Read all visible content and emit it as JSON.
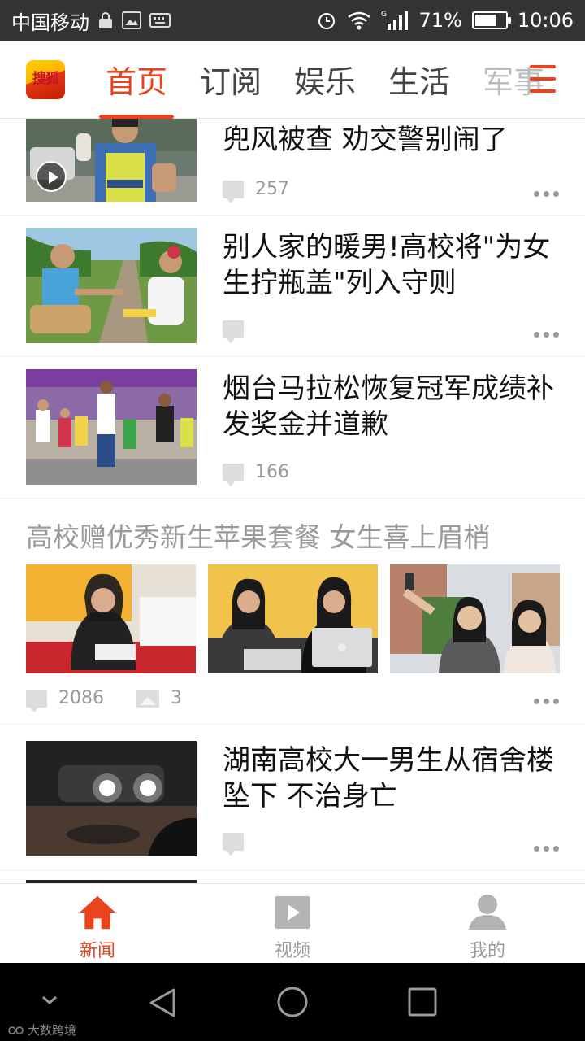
{
  "status_bar": {
    "carrier": "中国移动",
    "signal_tag": "G",
    "battery": "71%",
    "battery_level": 0.71,
    "time": "10:06"
  },
  "app": {
    "logo_text": "搜狐",
    "tabs": [
      {
        "label": "首页",
        "active": true
      },
      {
        "label": "订阅",
        "active": false
      },
      {
        "label": "娱乐",
        "active": false
      },
      {
        "label": "生活",
        "active": false
      },
      {
        "label": "军事",
        "active": false
      }
    ]
  },
  "feed": {
    "items": [
      {
        "title": "兜风被查 劝交警别闹了",
        "comments": "257",
        "has_video": true,
        "image": "traffic-police-photo"
      },
      {
        "title": "别人家的暖男!高校将\"为女生拧瓶盖\"列入守则",
        "comments": "",
        "has_video": false,
        "image": "couple-on-railway-photo"
      },
      {
        "title": "烟台马拉松恢复冠军成绩补发奖金并道歉",
        "comments": "166",
        "has_video": false,
        "image": "marathon-runners-photo"
      }
    ],
    "gallery": {
      "title": "高校赠优秀新生苹果套餐 女生喜上眉梢",
      "comments": "2086",
      "photo_count": "3",
      "images": [
        "student-with-iphone-box",
        "students-with-macbook",
        "students-selfie"
      ]
    },
    "last_item": {
      "title": "湖南高校大一男生从宿舍楼坠下 不治身亡",
      "comments": "",
      "image": "night-accident-photo"
    }
  },
  "bottom_nav": [
    {
      "label": "新闻",
      "icon": "home-icon",
      "active": true
    },
    {
      "label": "视频",
      "icon": "video-icon",
      "active": false
    },
    {
      "label": "我的",
      "icon": "profile-icon",
      "active": false
    }
  ],
  "watermark": "大数跨境",
  "colors": {
    "accent": "#e8451e",
    "status_bar": "#333333",
    "meta_gray": "#999999"
  }
}
